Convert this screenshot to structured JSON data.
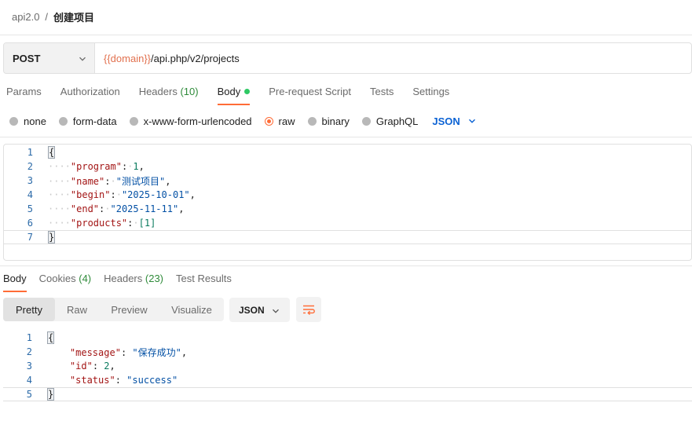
{
  "breadcrumb": {
    "parent": "api2.0",
    "separator": "/",
    "current": "创建项目"
  },
  "request": {
    "method": "POST",
    "url_variable": "{{domain}}",
    "url_path": "/api.php/v2/projects"
  },
  "request_tabs": [
    {
      "label": "Params"
    },
    {
      "label": "Authorization"
    },
    {
      "label": "Headers",
      "count": "(10)"
    },
    {
      "label": "Body",
      "active": true
    },
    {
      "label": "Pre-request Script"
    },
    {
      "label": "Tests"
    },
    {
      "label": "Settings"
    }
  ],
  "body_types": [
    "none",
    "form-data",
    "x-www-form-urlencoded",
    "raw",
    "binary",
    "GraphQL"
  ],
  "body_type_selected": "raw",
  "body_format": "JSON",
  "request_body": {
    "line_numbers": [
      "1",
      "2",
      "3",
      "4",
      "5",
      "6",
      "7"
    ],
    "open_brace": "{",
    "close_brace": "}",
    "lines": [
      {
        "key": "\"program\"",
        "value": "1"
      },
      {
        "key": "\"name\"",
        "value": "\"测试项目\""
      },
      {
        "key": "\"begin\"",
        "value": "\"2025-10-01\""
      },
      {
        "key": "\"end\"",
        "value": "\"2025-11-11\""
      },
      {
        "key": "\"products\"",
        "value": "[1]"
      }
    ]
  },
  "response_tabs": [
    {
      "label": "Body",
      "active": true
    },
    {
      "label": "Cookies",
      "count": "(4)"
    },
    {
      "label": "Headers",
      "count": "(23)"
    },
    {
      "label": "Test Results"
    }
  ],
  "response_views": [
    "Pretty",
    "Raw",
    "Preview",
    "Visualize"
  ],
  "response_view_selected": "Pretty",
  "response_format": "JSON",
  "response_body": {
    "line_numbers": [
      "1",
      "2",
      "3",
      "4",
      "5"
    ],
    "open_brace": "{",
    "close_brace": "}",
    "lines": [
      {
        "key": "\"message\"",
        "value": "\"保存成功\""
      },
      {
        "key": "\"id\"",
        "value": "2"
      },
      {
        "key": "\"status\"",
        "value": "\"success\""
      }
    ]
  },
  "colors": {
    "accent": "#ff6c37",
    "link_blue": "#0b62d4",
    "count_green": "#2f8b3a",
    "body_dot": "#2ec964"
  }
}
